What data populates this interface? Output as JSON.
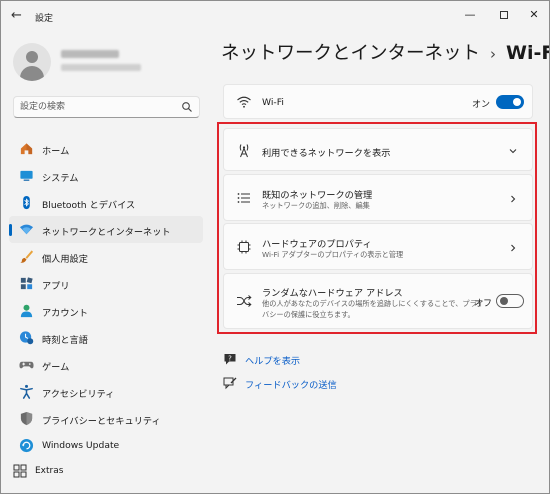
{
  "titlebar": {
    "back_icon": "back-arrow-icon",
    "title": "設定"
  },
  "search": {
    "placeholder": "設定の検索"
  },
  "sidebar": {
    "items": [
      {
        "label": "ホーム",
        "icon": "home-icon"
      },
      {
        "label": "システム",
        "icon": "system-icon"
      },
      {
        "label": "Bluetooth とデバイス",
        "icon": "bluetooth-icon"
      },
      {
        "label": "ネットワークとインターネット",
        "icon": "network-icon",
        "selected": true
      },
      {
        "label": "個人用設定",
        "icon": "paintbrush-icon"
      },
      {
        "label": "アプリ",
        "icon": "apps-icon"
      },
      {
        "label": "アカウント",
        "icon": "account-icon"
      },
      {
        "label": "時刻と言語",
        "icon": "time-language-icon"
      },
      {
        "label": "ゲーム",
        "icon": "gamepad-icon"
      },
      {
        "label": "アクセシビリティ",
        "icon": "accessibility-icon"
      },
      {
        "label": "プライバシーとセキュリティ",
        "icon": "shield-icon"
      },
      {
        "label": "Windows Update",
        "icon": "windows-update-icon"
      }
    ],
    "extras": {
      "label": "Extras",
      "icon": "extras-icon"
    }
  },
  "main": {
    "breadcrumb_parent": "ネットワークとインターネット",
    "breadcrumb_sep": "›",
    "breadcrumb_current": "Wi-Fi",
    "wifi": {
      "label": "Wi-Fi",
      "state_label": "オン",
      "on": true
    },
    "available": {
      "label": "利用できるネットワークを表示"
    },
    "known": {
      "title": "既知のネットワークの管理",
      "subtitle": "ネットワークの追加、削除、編集"
    },
    "hardware": {
      "title": "ハードウェアのプロパティ",
      "subtitle": "Wi-Fi アダプターのプロパティの表示と管理"
    },
    "random": {
      "title": "ランダムなハードウェア アドレス",
      "subtitle_line1": "他の人があなたのデバイスの場所を追跡しにくくすることで、プライ",
      "subtitle_line2": "バシーの保護に役立ちます。",
      "state_label": "オフ",
      "on": false
    },
    "help_link": "ヘルプを表示",
    "feedback_link": "フィードバックの送信"
  },
  "colors": {
    "accent": "#0067c0",
    "highlight": "#e0232b",
    "link": "#0a5ec8"
  }
}
